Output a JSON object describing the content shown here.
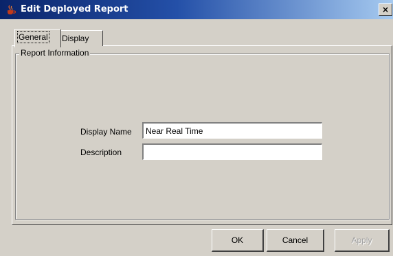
{
  "window": {
    "title": "Edit Deployed Report",
    "close_glyph": "×"
  },
  "tabs": [
    {
      "label": "General",
      "active": true
    },
    {
      "label": "Display",
      "active": false
    }
  ],
  "group": {
    "legend": "Report Information"
  },
  "fields": {
    "display_name": {
      "label": "Display Name",
      "value": "Near Real Time"
    },
    "description": {
      "label": "Description",
      "value": ""
    }
  },
  "buttons": {
    "ok": "OK",
    "cancel": "Cancel",
    "apply": "Apply"
  },
  "colors": {
    "titlebar_start": "#0a246a",
    "titlebar_end": "#a6caf0",
    "face": "#d4d0c8",
    "disabled_text": "#a0a0a0"
  },
  "icons": {
    "app": "java-cup-icon",
    "close": "close-icon"
  }
}
